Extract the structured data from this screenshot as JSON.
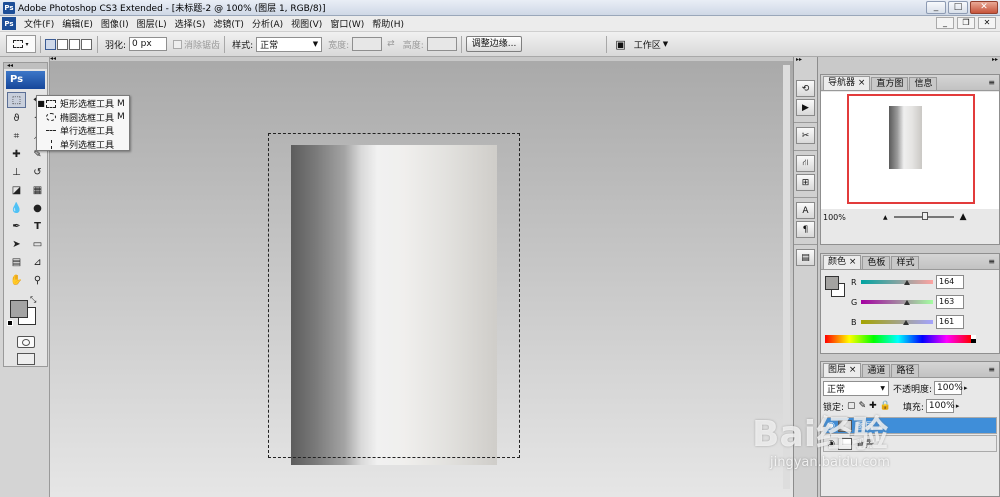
{
  "window": {
    "title": "Adobe Photoshop CS3 Extended - [未标题-2 @ 100% (图层 1, RGB/8)]",
    "app_icon": "Ps"
  },
  "menubar": {
    "items": [
      "文件(F)",
      "编辑(E)",
      "图像(I)",
      "图层(L)",
      "选择(S)",
      "滤镜(T)",
      "分析(A)",
      "视图(V)",
      "窗口(W)",
      "帮助(H)"
    ]
  },
  "options_bar": {
    "feather_label": "羽化:",
    "feather_value": "0 px",
    "antialias_label": "消除锯齿",
    "style_label": "样式:",
    "style_value": "正常",
    "width_label": "宽度:",
    "height_label": "高度:",
    "refine_edge": "调整边缘...",
    "workspace": "工作区"
  },
  "toolbox": {
    "logo": "Ps",
    "tools": [
      "marquee-icon",
      "lasso-icon",
      "crop-icon",
      "slice-icon",
      "heal-icon",
      "brush-icon",
      "stamp-icon",
      "history-brush-icon",
      "eraser-icon",
      "gradient-icon",
      "blur-icon",
      "dodge-icon",
      "pen-icon",
      "type-icon",
      "path-select-icon",
      "shape-icon",
      "notes-icon",
      "eyedropper-icon",
      "hand-icon",
      "zoom-icon"
    ],
    "fg_color": "#a4a4a4",
    "bg_color": "#ffffff"
  },
  "flyout": {
    "items": [
      {
        "label": "矩形选框工具",
        "key": "M",
        "icon": "rect-marquee-icon",
        "selected": true
      },
      {
        "label": "椭圆选框工具",
        "key": "M",
        "icon": "ellipse-marquee-icon",
        "selected": false
      },
      {
        "label": "单行选框工具",
        "key": "",
        "icon": "single-row-icon",
        "selected": false
      },
      {
        "label": "单列选框工具",
        "key": "",
        "icon": "single-column-icon",
        "selected": false
      }
    ]
  },
  "navigator": {
    "tabs": [
      "导航器",
      "直方图",
      "信息"
    ],
    "zoom": "100%"
  },
  "color_panel": {
    "tabs": [
      "颜色",
      "色板",
      "样式"
    ],
    "channels": [
      {
        "label": "R",
        "value": "164",
        "fraction": 0.643
      },
      {
        "label": "G",
        "value": "163",
        "fraction": 0.639
      },
      {
        "label": "B",
        "value": "161",
        "fraction": 0.631
      }
    ],
    "fg_color": "#a4a3a1"
  },
  "layers_panel": {
    "tabs": [
      "图层",
      "通道",
      "路径"
    ],
    "blend_mode": "正常",
    "opacity_label": "不透明度:",
    "opacity_value": "100%",
    "lock_label": "锁定:",
    "fill_label": "填充:",
    "fill_value": "100%",
    "layers": [
      {
        "name": "图层 1",
        "selected": true
      },
      {
        "name": "背景",
        "selected": false
      }
    ]
  },
  "watermark": {
    "main": "Bai经验",
    "sub": "jingyan.baidu.com"
  }
}
